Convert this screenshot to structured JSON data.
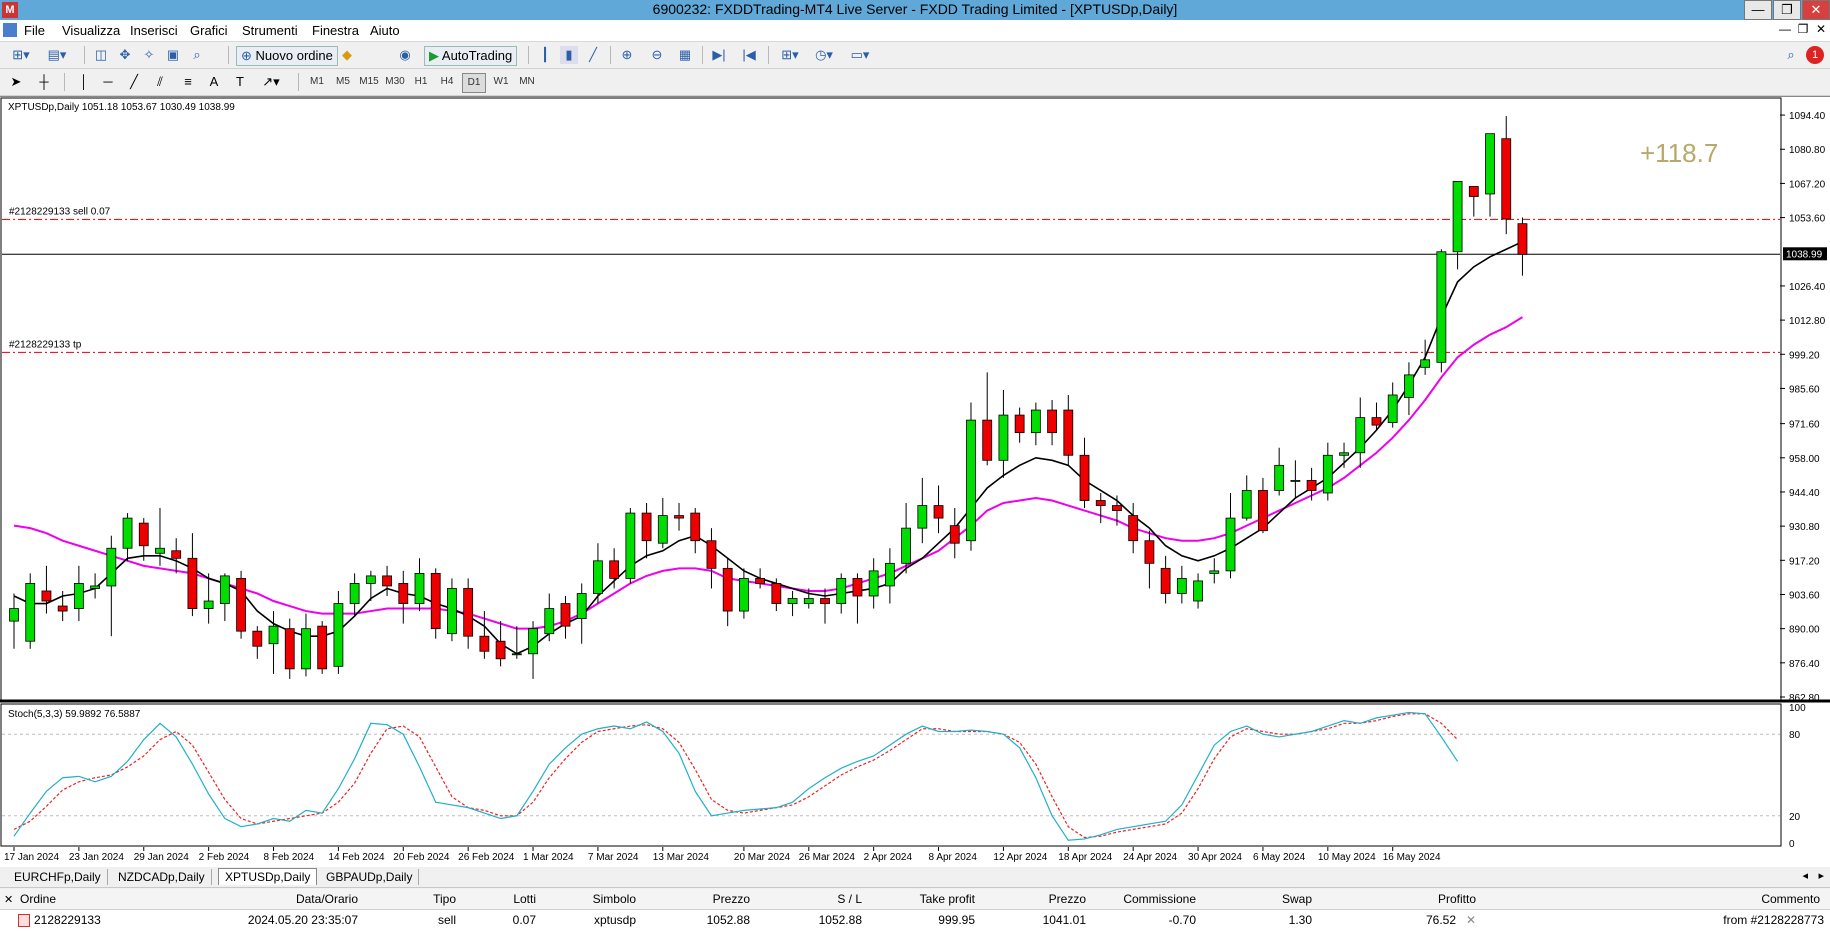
{
  "window": {
    "title": "6900232: FXDDTrading-MT4 Live Server - FXDD Trading Limited - [XPTUSDp,Daily]",
    "controls": [
      "—",
      "❐",
      "✕"
    ]
  },
  "menu": {
    "items": [
      "File",
      "Visualizza",
      "Inserisci",
      "Grafici",
      "Strumenti",
      "Finestra",
      "Aiuto"
    ],
    "mdi_controls": [
      "—",
      "❐",
      "✕"
    ]
  },
  "toolbar": {
    "new_order_label": "Nuovo ordine",
    "autotrading_label": "AutoTrading",
    "timeframes": [
      "M1",
      "M5",
      "M15",
      "M30",
      "H1",
      "H4",
      "D1",
      "W1",
      "MN"
    ],
    "active_timeframe": "D1",
    "notification_count": "1"
  },
  "chart": {
    "header": "XPTUSDp,Daily  1051.18 1053.67 1030.49 1038.99",
    "profit_display": "+118.7",
    "order_sell_label": "#2128229133 sell 0.07",
    "order_tp_label": "#2128229133 tp",
    "current_price_label": "1038.99",
    "stoch_header": "Stoch(5,3,3) 59.9892 76.5887",
    "colors": {
      "bull": "#00dd00",
      "bear": "#ee0000",
      "ma_fast": "#000000",
      "ma_slow": "#ee00ee",
      "stoch_main": "#20b0c8",
      "stoch_signal": "#ee2222",
      "order_line": "#dd0000",
      "profit_text": "#b8a86a"
    }
  },
  "chart_data": {
    "type": "candlestick",
    "symbol": "XPTUSDp",
    "timeframe": "Daily",
    "ylim": [
      862.8,
      1100
    ],
    "y_ticks": [
      1094.4,
      1080.8,
      1067.2,
      1053.6,
      1040,
      1026.4,
      1012.8,
      999.2,
      985.6,
      971.6,
      958.0,
      944.4,
      930.8,
      917.2,
      903.6,
      890.0,
      876.4,
      862.8
    ],
    "y_tick_labels": [
      "1094.40",
      "1080.80",
      "1067.20",
      "1053.60",
      "1026.40",
      "1012.80",
      "999.20",
      "985.60",
      "971.60",
      "958.00",
      "944.40",
      "930.80",
      "917.20",
      "903.60",
      "890.00",
      "876.40",
      "862.80"
    ],
    "x_tick_labels": [
      "17 Jan 2024",
      "23 Jan 2024",
      "29 Jan 2024",
      "2 Feb 2024",
      "8 Feb 2024",
      "14 Feb 2024",
      "20 Feb 2024",
      "26 Feb 2024",
      "1 Mar 2024",
      "7 Mar 2024",
      "13 Mar 2024",
      "20 Mar 2024",
      "26 Mar 2024",
      "2 Apr 2024",
      "8 Apr 2024",
      "12 Apr 2024",
      "18 Apr 2024",
      "24 Apr 2024",
      "30 Apr 2024",
      "6 May 2024",
      "10 May 2024",
      "16 May 2024"
    ],
    "x_tick_bar_index": [
      0,
      4,
      8,
      12,
      16,
      20,
      24,
      28,
      32,
      36,
      40,
      45,
      49,
      53,
      57,
      61,
      65,
      69,
      73,
      77,
      81,
      85
    ],
    "order_lines": {
      "sell_open": 1052.88,
      "take_profit": 999.95,
      "current_price": 1038.99
    },
    "candles": [
      [
        893,
        898,
        882,
        904
      ],
      [
        885,
        908,
        882,
        912
      ],
      [
        905,
        901,
        896,
        915
      ],
      [
        899,
        897,
        893,
        905
      ],
      [
        898,
        908,
        893,
        915
      ],
      [
        906,
        907,
        902,
        912
      ],
      [
        907,
        922,
        887,
        927
      ],
      [
        922,
        934,
        917,
        936
      ],
      [
        932,
        923,
        917,
        934
      ],
      [
        920,
        922,
        915,
        938
      ],
      [
        921,
        918,
        912,
        926
      ],
      [
        918,
        898,
        895,
        928
      ],
      [
        898,
        901,
        892,
        912
      ],
      [
        900,
        911,
        893,
        912
      ],
      [
        910,
        889,
        886,
        913
      ],
      [
        889,
        883,
        878,
        891
      ],
      [
        884,
        891,
        872,
        897
      ],
      [
        890,
        874,
        870,
        894
      ],
      [
        874,
        890,
        871,
        896
      ],
      [
        891,
        874,
        872,
        893
      ],
      [
        875,
        900,
        872,
        905
      ],
      [
        900,
        908,
        895,
        912
      ],
      [
        908,
        911,
        901,
        913
      ],
      [
        911,
        907,
        903,
        915
      ],
      [
        908,
        900,
        892,
        913
      ],
      [
        900,
        912,
        897,
        918
      ],
      [
        912,
        890,
        886,
        914
      ],
      [
        888,
        906,
        885,
        910
      ],
      [
        906,
        887,
        882,
        910
      ],
      [
        887,
        881,
        878,
        897
      ],
      [
        885,
        878,
        875,
        893
      ],
      [
        880,
        880,
        878,
        891
      ],
      [
        880,
        890,
        870,
        893
      ],
      [
        888,
        898,
        885,
        904
      ],
      [
        900,
        891,
        886,
        903
      ],
      [
        894,
        904,
        884,
        908
      ],
      [
        904,
        917,
        900,
        924
      ],
      [
        917,
        910,
        906,
        922
      ],
      [
        910,
        936,
        908,
        938
      ],
      [
        936,
        925,
        918,
        940
      ],
      [
        924,
        935,
        922,
        942
      ],
      [
        935,
        934,
        929,
        940
      ],
      [
        936,
        925,
        920,
        938
      ],
      [
        925,
        914,
        906,
        930
      ],
      [
        914,
        897,
        891,
        918
      ],
      [
        897,
        910,
        894,
        914
      ],
      [
        910,
        908,
        906,
        914
      ],
      [
        908,
        900,
        897,
        910
      ],
      [
        900,
        902,
        895,
        905
      ],
      [
        900,
        902,
        898,
        906
      ],
      [
        902,
        900,
        892,
        906
      ],
      [
        900,
        910,
        896,
        912
      ],
      [
        910,
        903,
        892,
        912
      ],
      [
        903,
        913,
        898,
        918
      ],
      [
        907,
        916,
        900,
        922
      ],
      [
        916,
        930,
        912,
        940
      ],
      [
        930,
        939,
        924,
        950
      ],
      [
        939,
        934,
        928,
        947
      ],
      [
        931,
        924,
        918,
        938
      ],
      [
        925,
        973,
        921,
        980
      ],
      [
        973,
        957,
        955,
        992
      ],
      [
        957,
        975,
        950,
        985
      ],
      [
        975,
        968,
        964,
        978
      ],
      [
        968,
        977,
        963,
        980
      ],
      [
        977,
        968,
        963,
        981
      ],
      [
        977,
        959,
        955,
        983
      ],
      [
        959,
        941,
        938,
        966
      ],
      [
        941,
        939,
        932,
        944
      ],
      [
        939,
        937,
        931,
        943
      ],
      [
        935,
        925,
        920,
        940
      ],
      [
        925,
        916,
        906,
        929
      ],
      [
        914,
        904,
        900,
        919
      ],
      [
        904,
        910,
        900,
        915
      ],
      [
        901,
        909,
        898,
        912
      ],
      [
        912,
        913,
        908,
        918
      ],
      [
        913,
        934,
        910,
        944
      ],
      [
        934,
        945,
        933,
        951
      ],
      [
        945,
        929,
        928,
        950
      ],
      [
        945,
        955,
        943,
        962
      ],
      [
        949,
        949,
        942,
        957
      ],
      [
        949,
        945,
        941,
        954
      ],
      [
        944,
        959,
        941,
        964
      ],
      [
        959,
        960,
        954,
        964
      ],
      [
        960,
        974,
        954,
        982
      ],
      [
        974,
        971,
        969,
        980
      ],
      [
        972,
        983,
        970,
        988
      ],
      [
        982,
        991,
        975,
        996
      ],
      [
        994,
        997,
        991,
        1005
      ],
      [
        996,
        1040,
        992,
        1041
      ],
      [
        1040,
        1068,
        1033,
        1068
      ],
      [
        1066,
        1062,
        1054,
        1064
      ],
      [
        1063,
        1087,
        1054,
        1087
      ],
      [
        1085,
        1053,
        1047,
        1094
      ],
      [
        1051.18,
        1038.99,
        1030.49,
        1053.67
      ]
    ],
    "ma_fast": [
      903,
      900,
      900,
      903,
      904,
      906,
      912,
      918,
      919,
      919,
      917,
      914,
      910,
      908,
      905,
      897,
      892,
      889,
      887,
      887,
      889,
      895,
      902,
      906,
      904,
      903,
      900,
      898,
      895,
      891,
      884,
      880,
      883,
      888,
      892,
      895,
      903,
      909,
      915,
      919,
      921,
      925,
      927,
      923,
      918,
      913,
      910,
      908,
      906,
      904,
      903,
      904,
      905,
      906,
      908,
      914,
      918,
      924,
      930,
      938,
      946,
      951,
      955,
      958,
      957,
      955,
      949,
      945,
      941,
      935,
      930,
      923,
      919,
      917,
      919,
      922,
      926,
      930,
      936,
      942,
      946,
      950,
      956,
      962,
      969,
      977,
      987,
      998,
      1014,
      1028,
      1034,
      1038,
      1041,
      1044
    ],
    "ma_slow": [
      931,
      930,
      928,
      925,
      923,
      921,
      919,
      917,
      915,
      914,
      913,
      912,
      910,
      908,
      906,
      904,
      901,
      899,
      897,
      896,
      896,
      896,
      897,
      898,
      898,
      898,
      898,
      897,
      896,
      894,
      892,
      890,
      890,
      891,
      893,
      896,
      900,
      904,
      908,
      911,
      913,
      914,
      914,
      913,
      910,
      909,
      908,
      907,
      906,
      905,
      905,
      906,
      908,
      910,
      912,
      915,
      918,
      921,
      926,
      931,
      937,
      940,
      941,
      942,
      941,
      939,
      937,
      935,
      933,
      930,
      928,
      926,
      925,
      925,
      926,
      928,
      931,
      934,
      937,
      940,
      943,
      946,
      950,
      955,
      960,
      966,
      973,
      981,
      990,
      998,
      1003,
      1007,
      1010,
      1014
    ],
    "stoch_range": [
      0,
      100
    ],
    "stoch_levels": [
      20,
      80
    ],
    "stoch_main": [
      5,
      22,
      38,
      48,
      49,
      45,
      49,
      60,
      76,
      88,
      78,
      58,
      36,
      18,
      12,
      14,
      18,
      16,
      24,
      22,
      40,
      62,
      88,
      87,
      80,
      56,
      30,
      28,
      26,
      22,
      18,
      20,
      38,
      58,
      70,
      80,
      84,
      86,
      84,
      89,
      82,
      66,
      38,
      20,
      22,
      24,
      25,
      26,
      30,
      40,
      48,
      55,
      60,
      64,
      72,
      80,
      86,
      82,
      82,
      83,
      82,
      80,
      70,
      48,
      20,
      2,
      3,
      6,
      10,
      12,
      14,
      16,
      28,
      50,
      72,
      82,
      86,
      80,
      78,
      80,
      82,
      86,
      90,
      88,
      92,
      94,
      96,
      95,
      78,
      60
    ],
    "stoch_signal": [
      10,
      16,
      27,
      39,
      45,
      48,
      50,
      56,
      64,
      76,
      82,
      72,
      52,
      32,
      18,
      14,
      16,
      18,
      20,
      22,
      30,
      44,
      66,
      84,
      86,
      78,
      56,
      34,
      26,
      24,
      20,
      20,
      30,
      48,
      62,
      74,
      82,
      84,
      86,
      87,
      84,
      74,
      54,
      32,
      24,
      22,
      24,
      26,
      28,
      34,
      42,
      50,
      56,
      61,
      68,
      76,
      84,
      84,
      82,
      82,
      82,
      80,
      74,
      58,
      34,
      12,
      4,
      5,
      8,
      10,
      12,
      14,
      22,
      40,
      62,
      78,
      84,
      82,
      80,
      80,
      82,
      84,
      88,
      88,
      90,
      93,
      95,
      95,
      88,
      76
    ]
  },
  "symbol_tabs": [
    "EURCHFp,Daily",
    "NZDCADp,Daily",
    "XPTUSDp,Daily",
    "GBPAUDp,Daily"
  ],
  "active_symbol_tab": "XPTUSDp,Daily",
  "orders": {
    "headers": [
      "Ordine",
      "Data/Orario",
      "Tipo",
      "Lotti",
      "Simbolo",
      "Prezzo",
      "S / L",
      "Take profit",
      "Prezzo",
      "Commissione",
      "Swap",
      "Profitto",
      "Commento"
    ],
    "rows": [
      [
        "2128229133",
        "2024.05.20 23:35:07",
        "sell",
        "0.07",
        "xptusdp",
        "1052.88",
        "1052.88",
        "999.95",
        "1041.01",
        "-0.70",
        "1.30",
        "76.52",
        "from #2128228773"
      ]
    ]
  }
}
